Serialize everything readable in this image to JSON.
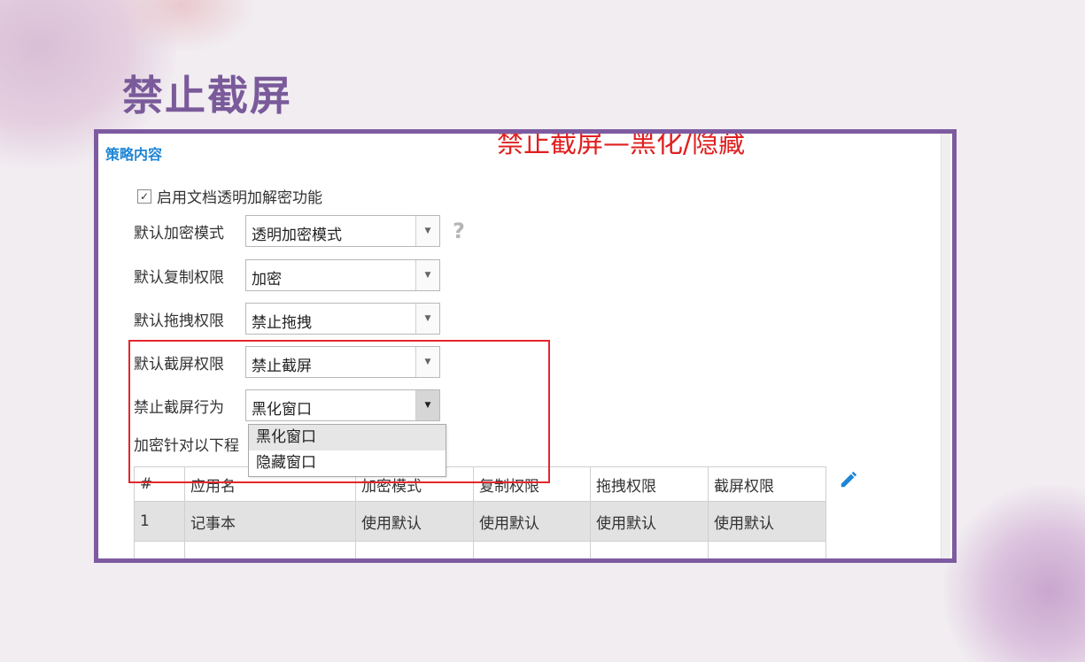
{
  "slide": {
    "title": "禁止截屏"
  },
  "banner": "禁止截屏—黑化/隐藏",
  "section_title": "策略内容",
  "checkbox": {
    "checked": true,
    "label": "启用文档透明加解密功能"
  },
  "form": [
    {
      "label": "默认加密模式",
      "value": "透明加密模式",
      "help": "?"
    },
    {
      "label": "默认复制权限",
      "value": "加密"
    },
    {
      "label": "默认拖拽权限",
      "value": "禁止拖拽"
    },
    {
      "label": "默认截屏权限",
      "value": "禁止截屏"
    },
    {
      "label": "禁止截屏行为",
      "value": "黑化窗口"
    }
  ],
  "dropdown": {
    "options": [
      "黑化窗口",
      "隐藏窗口"
    ]
  },
  "note": "加密针对以下程",
  "table": {
    "headers": [
      "#",
      "应用名",
      "加密模式",
      "复制权限",
      "拖拽权限",
      "截屏权限"
    ],
    "rows": [
      [
        "1",
        "记事本",
        "使用默认",
        "使用默认",
        "使用默认",
        "使用默认"
      ]
    ]
  },
  "colors": {
    "accent": "#7e5ba0",
    "highlight_border": "#e4262c",
    "banner": "#e02020",
    "link": "#1f86d6"
  },
  "icons": {
    "help": "question-mark-icon",
    "edit": "pencil-icon",
    "dropdown": "caret-down-icon",
    "check": "checkmark-icon"
  }
}
